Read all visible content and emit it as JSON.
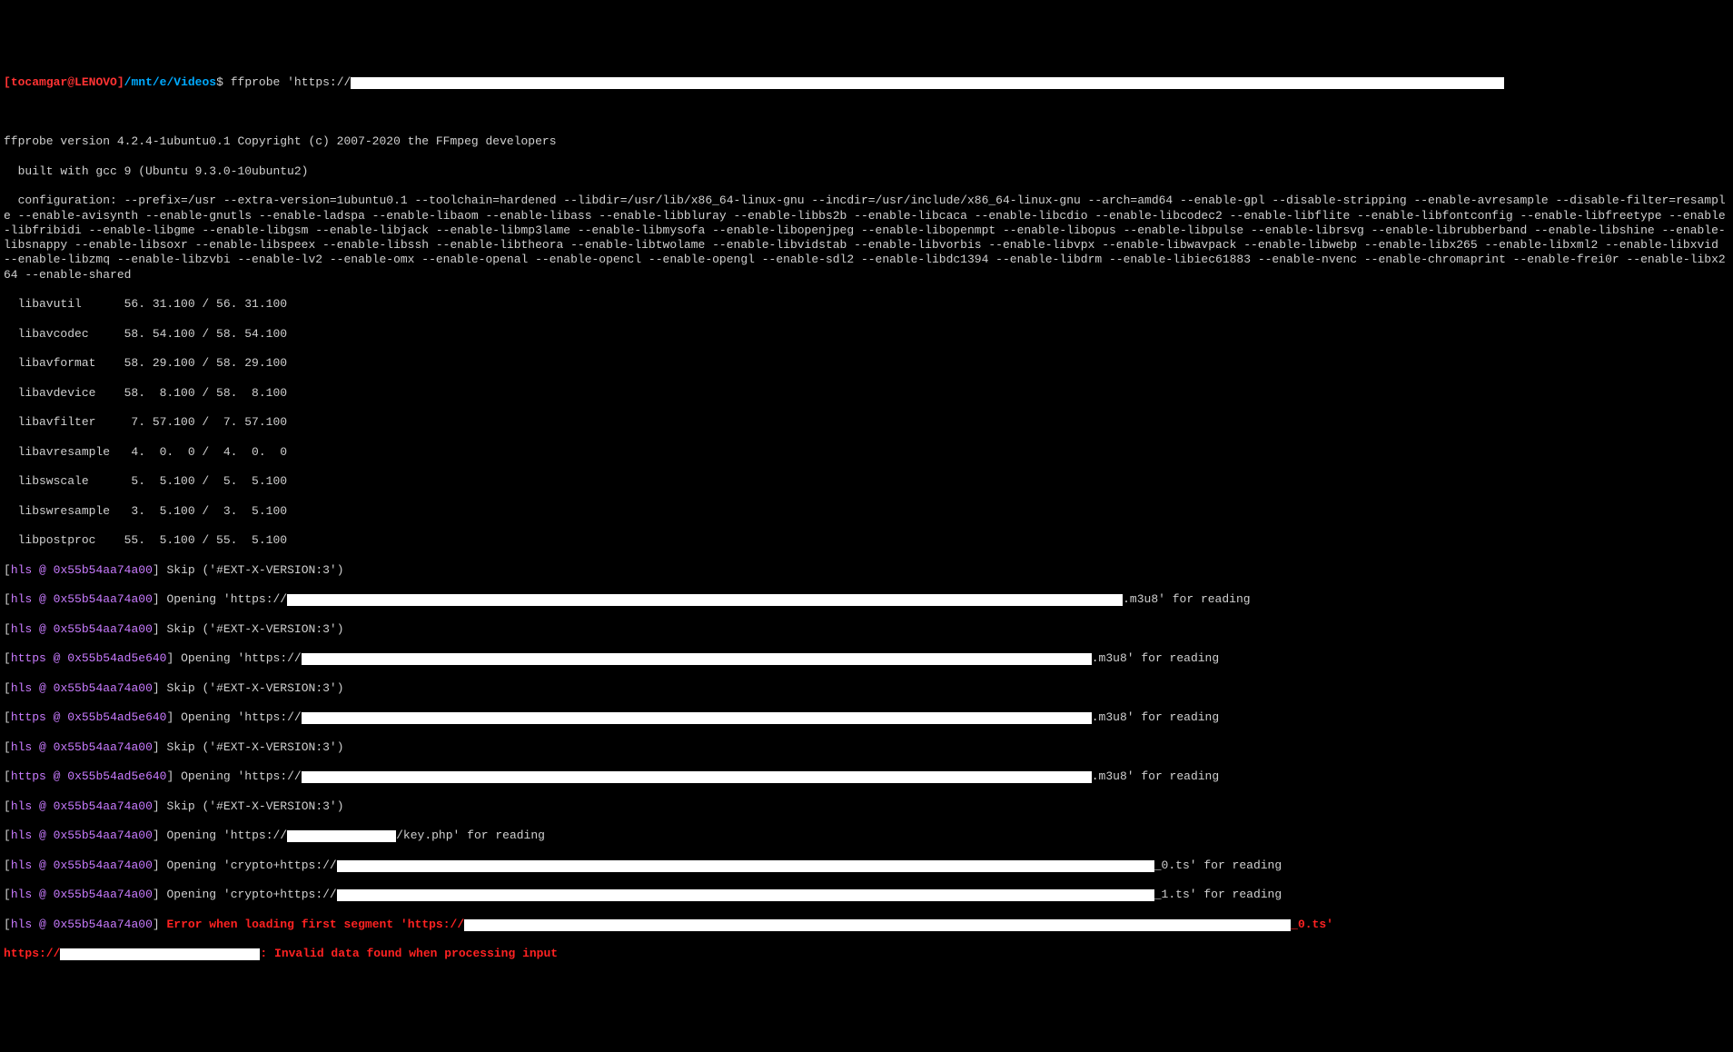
{
  "prompt": {
    "open": "[",
    "user": "tocamgar",
    "at": "@",
    "host": "LENOVO",
    "close": "]",
    "path": "/mnt/e/Videos",
    "sigil": "$",
    "command": "ffprobe 'https://"
  },
  "version": {
    "line1": "ffprobe version 4.2.4-1ubuntu0.1 Copyright (c) 2007-2020 the FFmpeg developers",
    "line2": "  built with gcc 9 (Ubuntu 9.3.0-10ubuntu2)",
    "config": "  configuration: --prefix=/usr --extra-version=1ubuntu0.1 --toolchain=hardened --libdir=/usr/lib/x86_64-linux-gnu --incdir=/usr/include/x86_64-linux-gnu --arch=amd64 --enable-gpl --disable-stripping --enable-avresample --disable-filter=resample --enable-avisynth --enable-gnutls --enable-ladspa --enable-libaom --enable-libass --enable-libbluray --enable-libbs2b --enable-libcaca --enable-libcdio --enable-libcodec2 --enable-libflite --enable-libfontconfig --enable-libfreetype --enable-libfribidi --enable-libgme --enable-libgsm --enable-libjack --enable-libmp3lame --enable-libmysofa --enable-libopenjpeg --enable-libopenmpt --enable-libopus --enable-libpulse --enable-librsvg --enable-librubberband --enable-libshine --enable-libsnappy --enable-libsoxr --enable-libspeex --enable-libssh --enable-libtheora --enable-libtwolame --enable-libvidstab --enable-libvorbis --enable-libvpx --enable-libwavpack --enable-libwebp --enable-libx265 --enable-libxml2 --enable-libxvid --enable-libzmq --enable-libzvbi --enable-lv2 --enable-omx --enable-openal --enable-opencl --enable-opengl --enable-sdl2 --enable-libdc1394 --enable-libdrm --enable-libiec61883 --enable-nvenc --enable-chromaprint --enable-frei0r --enable-libx264 --enable-shared"
  },
  "libs": {
    "l1": "  libavutil      56. 31.100 / 56. 31.100",
    "l2": "  libavcodec     58. 54.100 / 58. 54.100",
    "l3": "  libavformat    58. 29.100 / 58. 29.100",
    "l4": "  libavdevice    58.  8.100 / 58.  8.100",
    "l5": "  libavfilter     7. 57.100 /  7. 57.100",
    "l6": "  libavresample   4.  0.  0 /  4.  0.  0",
    "l7": "  libswscale      5.  5.100 /  5.  5.100",
    "l8": "  libswresample   3.  5.100 /  3.  5.100",
    "l9": "  libpostproc    55.  5.100 / 55.  5.100"
  },
  "hls": {
    "tag_hls": "hls",
    "tag_https": "https",
    "addr_hls": "0x55b54aa74a00",
    "addr_https": "0x55b54ad5e640",
    "skip": " Skip ('#EXT-X-VERSION:3')",
    "open_https_pre": " Opening 'https://",
    "open_crypto_pre": " Opening 'crypto+https://",
    "suffix_m3u8": ".m3u8' for reading",
    "suffix_key": "/key.php' for reading",
    "suffix_ts0": "_0.ts' for reading",
    "suffix_ts1": "_1.ts' for reading",
    "err_seg_pre": " Error when loading first segment 'https://",
    "err_seg_suf": "_0.ts'",
    "final_pre": "https://",
    "final_err": ": Invalid data found when processing input"
  }
}
